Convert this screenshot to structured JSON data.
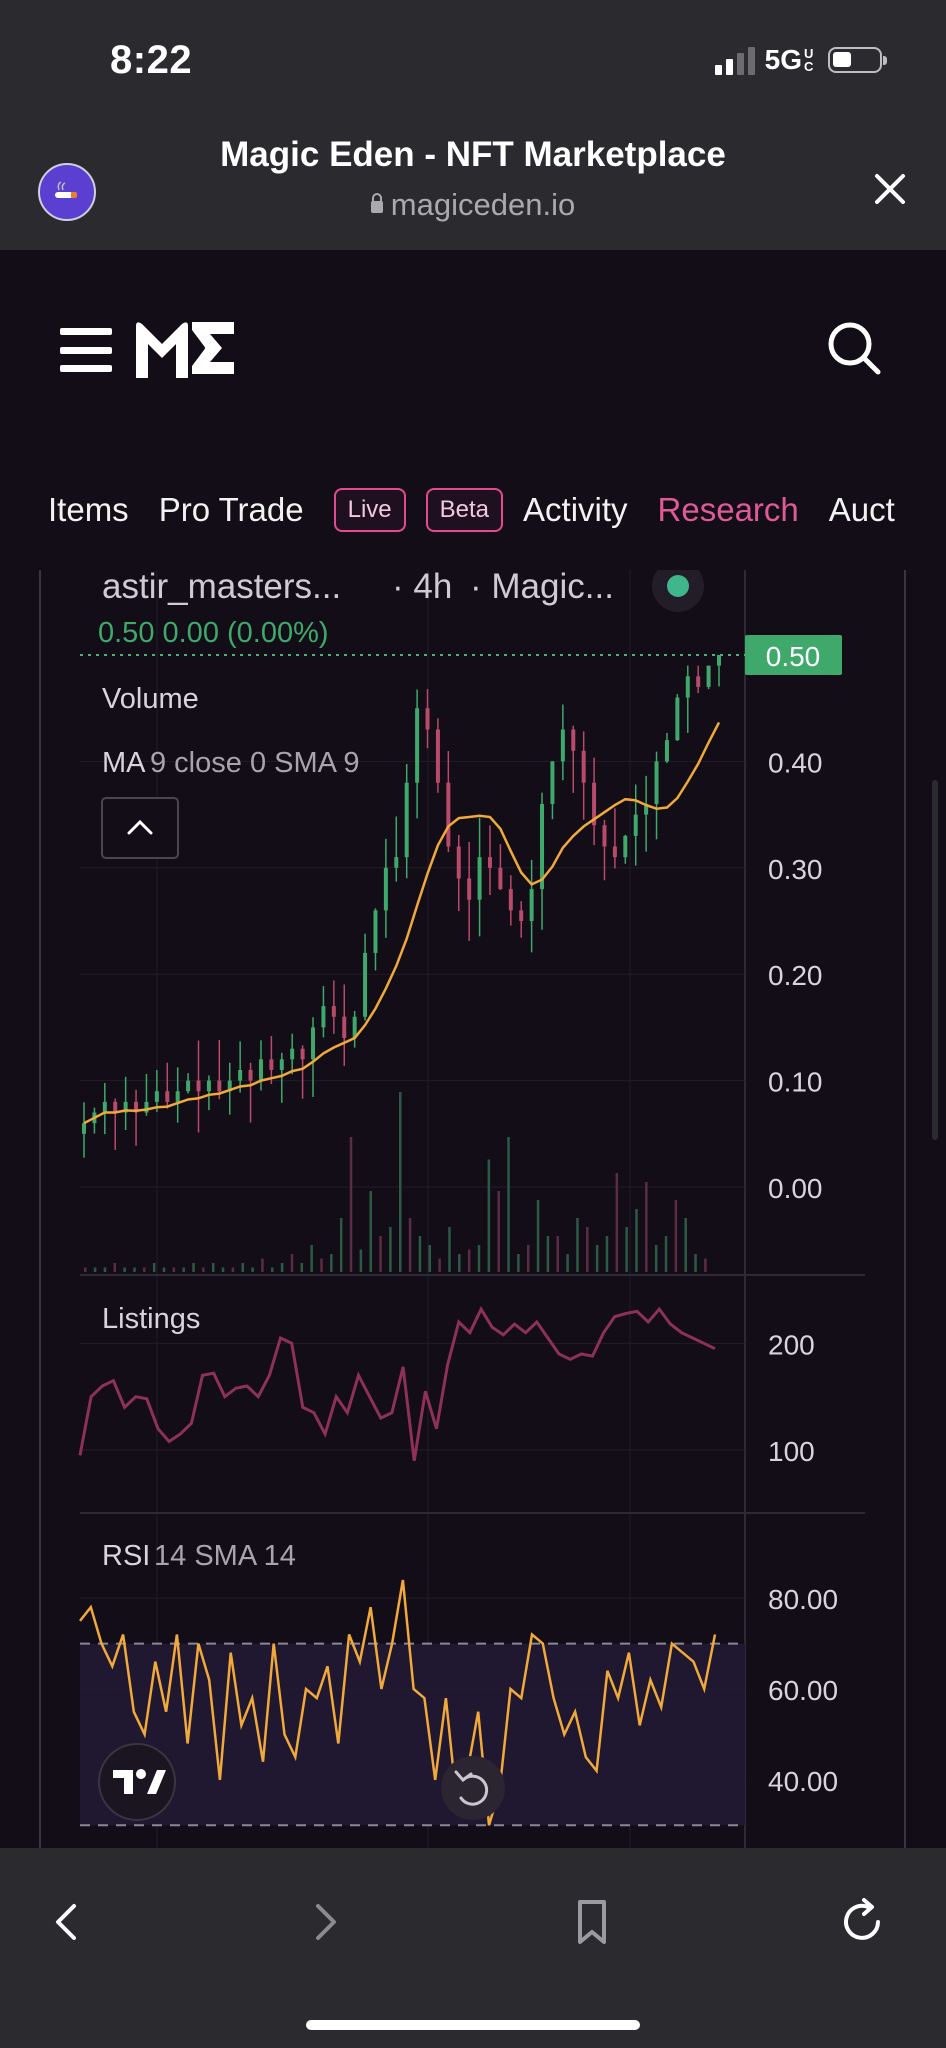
{
  "status_bar": {
    "time": "8:22",
    "network": "5G",
    "network_sup": "UC"
  },
  "browser": {
    "title": "Magic Eden - NFT Marketplace",
    "url": "magiceden.io"
  },
  "header": {
    "logo_alt": "ME"
  },
  "tabs": [
    {
      "label": "Items"
    },
    {
      "label": "Pro Trade"
    },
    {
      "label": "Live",
      "type": "pill"
    },
    {
      "label": "Beta",
      "type": "pill"
    },
    {
      "label": "Activity"
    },
    {
      "label": "Research",
      "active": true
    },
    {
      "label": "Auct"
    }
  ],
  "chart_header": {
    "symbol": "astir_masters...",
    "interval": "4h",
    "exchange": "Magic...",
    "ohlc_line": "0.50  0.00 (0.00%)",
    "volume_label": "Volume",
    "ma_label": "MA",
    "ma_params": "9 close 0 SMA 9",
    "last_price_tag": "0.50"
  },
  "chart_data": [
    {
      "type": "candlestick",
      "title": "astir_masters...",
      "y_ticks": [
        "0.50",
        "0.40",
        "0.30",
        "0.20",
        "0.10",
        "0.00"
      ],
      "ylim": [
        0.0,
        0.5
      ],
      "close": [
        0.06,
        0.07,
        0.08,
        0.07,
        0.08,
        0.07,
        0.08,
        0.09,
        0.08,
        0.09,
        0.1,
        0.09,
        0.1,
        0.09,
        0.1,
        0.11,
        0.1,
        0.12,
        0.11,
        0.12,
        0.13,
        0.12,
        0.15,
        0.17,
        0.16,
        0.14,
        0.16,
        0.22,
        0.26,
        0.3,
        0.31,
        0.38,
        0.45,
        0.43,
        0.38,
        0.32,
        0.29,
        0.27,
        0.31,
        0.3,
        0.28,
        0.26,
        0.25,
        0.28,
        0.36,
        0.4,
        0.43,
        0.41,
        0.38,
        0.34,
        0.32,
        0.31,
        0.33,
        0.35,
        0.36,
        0.4,
        0.42,
        0.46,
        0.48,
        0.47,
        0.49,
        0.5
      ],
      "ma_series": {
        "name": "MA 9",
        "color": "#f0a93a"
      }
    },
    {
      "type": "bar",
      "title": "Volume",
      "values": [
        1,
        1,
        1,
        2,
        1,
        1,
        1,
        2,
        1,
        1,
        1,
        2,
        1,
        2,
        1,
        1,
        2,
        1,
        3,
        1,
        2,
        4,
        2,
        6,
        3,
        4,
        12,
        30,
        5,
        18,
        8,
        10,
        40,
        12,
        8,
        6,
        3,
        10,
        4,
        5,
        6,
        25,
        18,
        30,
        4,
        6,
        16,
        8,
        8,
        4,
        12,
        10,
        6,
        8,
        22,
        10,
        14,
        20,
        6,
        8,
        16,
        12,
        4,
        3
      ]
    },
    {
      "type": "line",
      "title": "Listings",
      "y_ticks": [
        "200",
        "100"
      ],
      "ylim": [
        70,
        250
      ],
      "values": [
        95,
        150,
        160,
        165,
        140,
        150,
        148,
        120,
        108,
        115,
        125,
        170,
        172,
        150,
        158,
        160,
        150,
        170,
        205,
        200,
        140,
        135,
        115,
        150,
        135,
        170,
        150,
        130,
        135,
        178,
        90,
        155,
        120,
        180,
        220,
        210,
        232,
        215,
        208,
        218,
        210,
        220,
        205,
        190,
        185,
        190,
        188,
        210,
        225,
        228,
        230,
        220,
        232,
        218,
        210,
        205,
        200,
        195
      ],
      "color": "#8d3157"
    },
    {
      "type": "line",
      "title": "RSI",
      "params": "14 SMA 14",
      "y_ticks": [
        "80.00",
        "60.00",
        "40.00"
      ],
      "ylim": [
        25,
        95
      ],
      "bands": [
        70,
        30
      ],
      "values": [
        75,
        78,
        70,
        65,
        72,
        55,
        50,
        66,
        55,
        72,
        48,
        70,
        62,
        40,
        68,
        52,
        58,
        44,
        70,
        50,
        45,
        60,
        58,
        65,
        48,
        72,
        66,
        78,
        60,
        70,
        84,
        60,
        58,
        40,
        58,
        35,
        42,
        55,
        30,
        38,
        60,
        58,
        72,
        70,
        58,
        50,
        55,
        45,
        42,
        64,
        58,
        68,
        52,
        62,
        56,
        70,
        68,
        66,
        60,
        72
      ],
      "color": "#f0a93a"
    }
  ]
}
